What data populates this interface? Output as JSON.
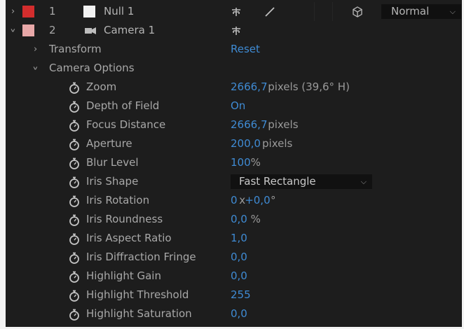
{
  "layers": [
    {
      "expand_icon": "chevron-right-icon",
      "color": "#d32d2d",
      "number": "1",
      "name": "Null 1",
      "type_icon": "null-swatch",
      "blend_mode": "Normal"
    },
    {
      "expand_icon": "chevron-down-icon",
      "color": "#e8a8a8",
      "number": "2",
      "name": "Camera 1",
      "type_icon": "camera-icon"
    }
  ],
  "transform": {
    "label": "Transform",
    "reset_label": "Reset"
  },
  "camera_options": {
    "label": "Camera Options",
    "properties": [
      {
        "label": "Zoom",
        "value": "2666,7",
        "unit": "pixels (39,6° H)"
      },
      {
        "label": "Depth of Field",
        "value": "On",
        "unit": ""
      },
      {
        "label": "Focus Distance",
        "value": "2666,7",
        "unit": "pixels"
      },
      {
        "label": "Aperture",
        "value": "200,0",
        "unit": "pixels"
      },
      {
        "label": "Blur Level",
        "value": "100",
        "unit": "%"
      },
      {
        "label": "Iris Shape",
        "dropdown": "Fast Rectangle"
      },
      {
        "label": "Iris Rotation",
        "value": "0",
        "mid": "x",
        "value2": "+0,0",
        "unit": "°"
      },
      {
        "label": "Iris Roundness",
        "value": "0,0",
        "unit": "%"
      },
      {
        "label": "Iris Aspect Ratio",
        "value": "1,0",
        "unit": ""
      },
      {
        "label": "Iris Diffraction Fringe",
        "value": "0,0",
        "unit": ""
      },
      {
        "label": "Highlight Gain",
        "value": "0,0",
        "unit": ""
      },
      {
        "label": "Highlight Threshold",
        "value": "255",
        "unit": ""
      },
      {
        "label": "Highlight Saturation",
        "value": "0,0",
        "unit": ""
      }
    ]
  }
}
